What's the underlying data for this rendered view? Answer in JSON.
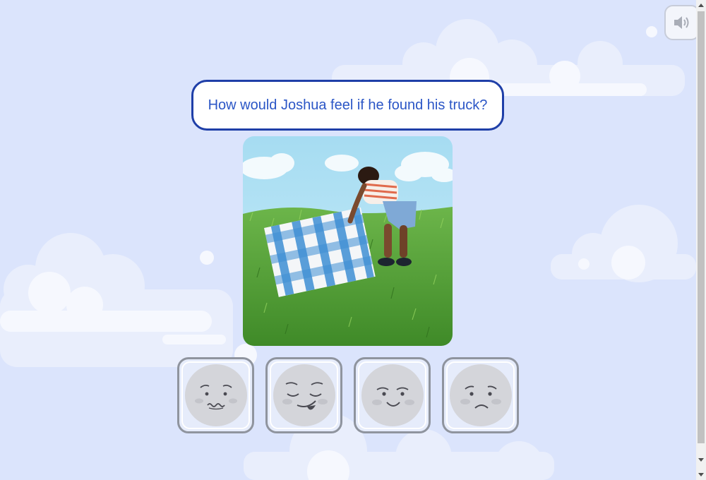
{
  "question": {
    "text": "How would Joshua feel if he found his truck?"
  },
  "audio_button": {
    "icon": "speaker-icon"
  },
  "scene_image": {
    "description": "",
    "colors": {
      "sky": "#aee0f3",
      "grass": "#4f9a2f",
      "blanket_blue": "#3f8fd4"
    }
  },
  "choices": [
    {
      "icon": "worried-face-icon",
      "emotion": "worried"
    },
    {
      "icon": "silly-face-icon",
      "emotion": "silly"
    },
    {
      "icon": "happy-face-icon",
      "emotion": "happy"
    },
    {
      "icon": "sad-face-icon",
      "emotion": "sad"
    }
  ],
  "colors": {
    "background": "#dbe4fc",
    "question_border": "#1f3fa8",
    "question_text": "#2b56c6",
    "choice_border": "#8f949e"
  }
}
